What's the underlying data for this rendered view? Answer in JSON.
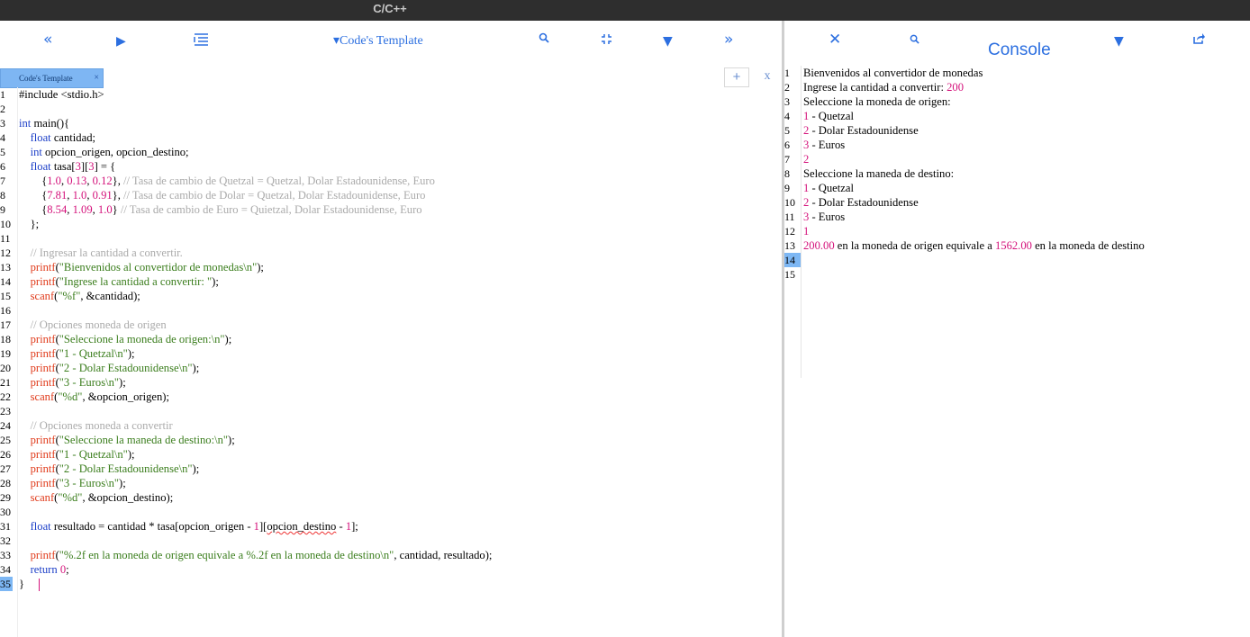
{
  "window": {
    "title": "C/C++"
  },
  "editor": {
    "toolbar": {
      "template_label": "▾Code's Template"
    },
    "tab": {
      "label": "Code's Template",
      "close": "×"
    },
    "tab_add": "+",
    "tab_close": "x",
    "active_line": 35,
    "lines": [
      [
        [
          "t",
          "#include <stdio.h>"
        ]
      ],
      [],
      [
        [
          "k",
          "int"
        ],
        [
          "t",
          " main(){"
        ]
      ],
      [
        [
          "t",
          "    "
        ],
        [
          "k",
          "float"
        ],
        [
          "t",
          " cantidad;"
        ]
      ],
      [
        [
          "t",
          "    "
        ],
        [
          "k",
          "int"
        ],
        [
          "t",
          " opcion_origen, opcion_destino;"
        ]
      ],
      [
        [
          "t",
          "    "
        ],
        [
          "k",
          "float"
        ],
        [
          "t",
          " tasa["
        ],
        [
          "n",
          "3"
        ],
        [
          "t",
          "]["
        ],
        [
          "n",
          "3"
        ],
        [
          "t",
          "] = {"
        ]
      ],
      [
        [
          "t",
          "        {"
        ],
        [
          "n",
          "1.0"
        ],
        [
          "t",
          ", "
        ],
        [
          "n",
          "0.13"
        ],
        [
          "t",
          ", "
        ],
        [
          "n",
          "0.12"
        ],
        [
          "t",
          "}, "
        ],
        [
          "c",
          "// Tasa de cambio de Quetzal = Quetzal, Dolar Estadounidense, Euro"
        ]
      ],
      [
        [
          "t",
          "        {"
        ],
        [
          "n",
          "7.81"
        ],
        [
          "t",
          ", "
        ],
        [
          "n",
          "1.0"
        ],
        [
          "t",
          ", "
        ],
        [
          "n",
          "0.91"
        ],
        [
          "t",
          "}, "
        ],
        [
          "c",
          "// Tasa de cambio de Dolar = Quetzal, Dolar Estadounidense, Euro"
        ]
      ],
      [
        [
          "t",
          "        {"
        ],
        [
          "n",
          "8.54"
        ],
        [
          "t",
          ", "
        ],
        [
          "n",
          "1.09"
        ],
        [
          "t",
          ", "
        ],
        [
          "n",
          "1.0"
        ],
        [
          "t",
          "} "
        ],
        [
          "c",
          "// Tasa de cambio de Euro = Quietzal, Dolar Estadounidense, Euro"
        ]
      ],
      [
        [
          "t",
          "    };"
        ]
      ],
      [],
      [
        [
          "t",
          "    "
        ],
        [
          "c",
          "// Ingresar la cantidad a convertir."
        ]
      ],
      [
        [
          "t",
          "    "
        ],
        [
          "f",
          "printf"
        ],
        [
          "t",
          "("
        ],
        [
          "s",
          "\"Bienvenidos al convertidor de monedas\\n\""
        ],
        [
          "t",
          ");"
        ]
      ],
      [
        [
          "t",
          "    "
        ],
        [
          "f",
          "printf"
        ],
        [
          "t",
          "("
        ],
        [
          "s",
          "\"Ingrese la cantidad a convertir: \""
        ],
        [
          "t",
          ");"
        ]
      ],
      [
        [
          "t",
          "    "
        ],
        [
          "f",
          "scanf"
        ],
        [
          "t",
          "("
        ],
        [
          "s",
          "\"%f\""
        ],
        [
          "t",
          ", &cantidad);"
        ]
      ],
      [],
      [
        [
          "t",
          "    "
        ],
        [
          "c",
          "// Opciones moneda de origen"
        ]
      ],
      [
        [
          "t",
          "    "
        ],
        [
          "f",
          "printf"
        ],
        [
          "t",
          "("
        ],
        [
          "s",
          "\"Seleccione la moneda de origen:\\n\""
        ],
        [
          "t",
          ");"
        ]
      ],
      [
        [
          "t",
          "    "
        ],
        [
          "f",
          "printf"
        ],
        [
          "t",
          "("
        ],
        [
          "s",
          "\"1 - Quetzal\\n\""
        ],
        [
          "t",
          ");"
        ]
      ],
      [
        [
          "t",
          "    "
        ],
        [
          "f",
          "printf"
        ],
        [
          "t",
          "("
        ],
        [
          "s",
          "\"2 - Dolar Estadounidense\\n\""
        ],
        [
          "t",
          ");"
        ]
      ],
      [
        [
          "t",
          "    "
        ],
        [
          "f",
          "printf"
        ],
        [
          "t",
          "("
        ],
        [
          "s",
          "\"3 - Euros\\n\""
        ],
        [
          "t",
          ");"
        ]
      ],
      [
        [
          "t",
          "    "
        ],
        [
          "f",
          "scanf"
        ],
        [
          "t",
          "("
        ],
        [
          "s",
          "\"%d\""
        ],
        [
          "t",
          ", &opcion_origen);"
        ]
      ],
      [],
      [
        [
          "t",
          "    "
        ],
        [
          "c",
          "// Opciones moneda a convertir"
        ]
      ],
      [
        [
          "t",
          "    "
        ],
        [
          "f",
          "printf"
        ],
        [
          "t",
          "("
        ],
        [
          "s",
          "\"Seleccione la maneda de destino:\\n\""
        ],
        [
          "t",
          ");"
        ]
      ],
      [
        [
          "t",
          "    "
        ],
        [
          "f",
          "printf"
        ],
        [
          "t",
          "("
        ],
        [
          "s",
          "\"1 - Quetzal\\n\""
        ],
        [
          "t",
          ");"
        ]
      ],
      [
        [
          "t",
          "    "
        ],
        [
          "f",
          "printf"
        ],
        [
          "t",
          "("
        ],
        [
          "s",
          "\"2 - Dolar Estadounidense\\n\""
        ],
        [
          "t",
          ");"
        ]
      ],
      [
        [
          "t",
          "    "
        ],
        [
          "f",
          "printf"
        ],
        [
          "t",
          "("
        ],
        [
          "s",
          "\"3 - Euros\\n\""
        ],
        [
          "t",
          ");"
        ]
      ],
      [
        [
          "t",
          "    "
        ],
        [
          "f",
          "scanf"
        ],
        [
          "t",
          "("
        ],
        [
          "s",
          "\"%d\""
        ],
        [
          "t",
          ", &opcion_destino);"
        ]
      ],
      [],
      [
        [
          "t",
          "    "
        ],
        [
          "k",
          "float"
        ],
        [
          "t",
          " resultado = cantidad * tasa[opcion_origen - "
        ],
        [
          "n",
          "1"
        ],
        [
          "t",
          "]["
        ],
        [
          "u",
          "opcion_destino"
        ],
        [
          "t",
          " - "
        ],
        [
          "n",
          "1"
        ],
        [
          "t",
          "];"
        ]
      ],
      [],
      [
        [
          "t",
          "    "
        ],
        [
          "f",
          "printf"
        ],
        [
          "t",
          "("
        ],
        [
          "s",
          "\"%.2f en la moneda de origen equivale a %.2f en la moneda de destino\\n\""
        ],
        [
          "t",
          ", cantidad, resultado);"
        ]
      ],
      [
        [
          "t",
          "    "
        ],
        [
          "k",
          "return"
        ],
        [
          "t",
          " "
        ],
        [
          "n",
          "0"
        ],
        [
          "t",
          ";"
        ]
      ],
      [
        [
          "t",
          "}"
        ]
      ]
    ]
  },
  "console": {
    "title": "Console",
    "active_line": 14,
    "total_lines": 15,
    "lines": [
      [
        [
          "t",
          "Bienvenidos al convertidor de monedas"
        ]
      ],
      [
        [
          "t",
          "Ingrese la cantidad a convertir: "
        ],
        [
          "p",
          "200"
        ]
      ],
      [
        [
          "t",
          "Seleccione la moneda de origen:"
        ]
      ],
      [
        [
          "p",
          "1"
        ],
        [
          "t",
          " - Quetzal"
        ]
      ],
      [
        [
          "p",
          "2"
        ],
        [
          "t",
          " - Dolar Estadounidense"
        ]
      ],
      [
        [
          "p",
          "3"
        ],
        [
          "t",
          " - Euros"
        ]
      ],
      [
        [
          "p",
          "2"
        ]
      ],
      [
        [
          "t",
          "Seleccione la maneda de destino:"
        ]
      ],
      [
        [
          "p",
          "1"
        ],
        [
          "t",
          " - Quetzal"
        ]
      ],
      [
        [
          "p",
          "2"
        ],
        [
          "t",
          " - Dolar Estadounidense"
        ]
      ],
      [
        [
          "p",
          "3"
        ],
        [
          "t",
          " - Euros"
        ]
      ],
      [
        [
          "p",
          "1"
        ]
      ],
      [
        [
          "p",
          "200.00"
        ],
        [
          "t",
          " en la moneda de origen equivale a "
        ],
        [
          "p",
          "1562.00"
        ],
        [
          "t",
          " en la moneda de destino"
        ]
      ],
      [],
      []
    ]
  },
  "icons": {
    "collapse_left": "«",
    "expand_right": "»",
    "run": "▶",
    "dropdown": "▼",
    "close": "✕"
  },
  "colors": {
    "accent": "#2c6fe0",
    "active_line": "#7db7f4",
    "number": "#d4127b",
    "string": "#3a7d1c",
    "keyword": "#1a3dc7",
    "function": "#e03a1a",
    "comment": "#aaaaaa"
  }
}
